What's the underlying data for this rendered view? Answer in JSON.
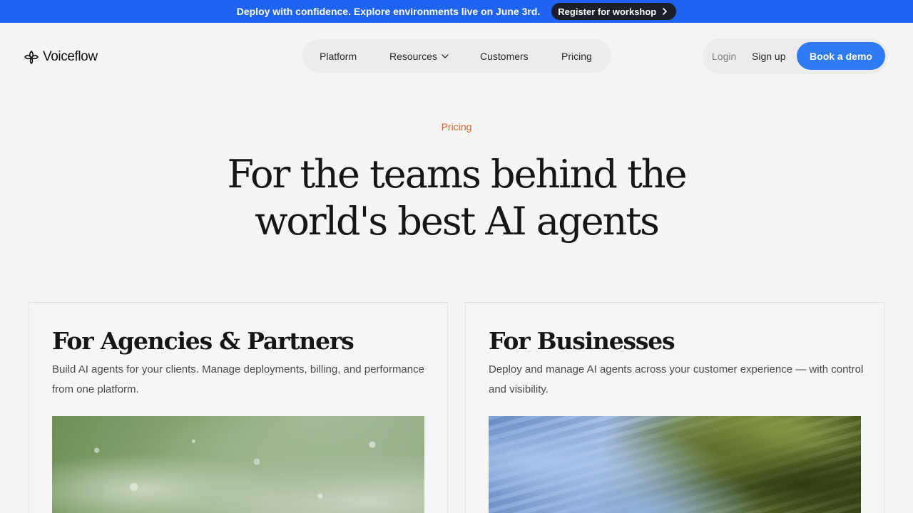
{
  "announcement": {
    "text": "Deploy with confidence. Explore environments live on June 3rd.",
    "button_label": "Register for workshop"
  },
  "header": {
    "logo_text": "Voiceflow",
    "nav": [
      {
        "label": "Platform"
      },
      {
        "label": "Resources"
      },
      {
        "label": "Customers"
      },
      {
        "label": "Pricing"
      }
    ],
    "login_label": "Login",
    "signup_label": "Sign up",
    "demo_label": "Book a demo"
  },
  "hero": {
    "eyebrow": "Pricing",
    "title_line1": "For the teams behind the",
    "title_line2": "world's best AI agents"
  },
  "cards": [
    {
      "title": "For Agencies & Partners",
      "description": "Build AI agents for your clients. Manage deployments, billing, and performance from one platform."
    },
    {
      "title": "For Businesses",
      "description": "Deploy and manage AI agents across your customer experience — with control and visibility."
    }
  ],
  "colors": {
    "announcement_bg": "#1f63f2",
    "accent_blue": "#2f7af5",
    "eyebrow_orange": "#e0622a"
  },
  "icons": [
    "voiceflow-logo-icon",
    "chevron-right-icon",
    "chevron-down-icon"
  ]
}
